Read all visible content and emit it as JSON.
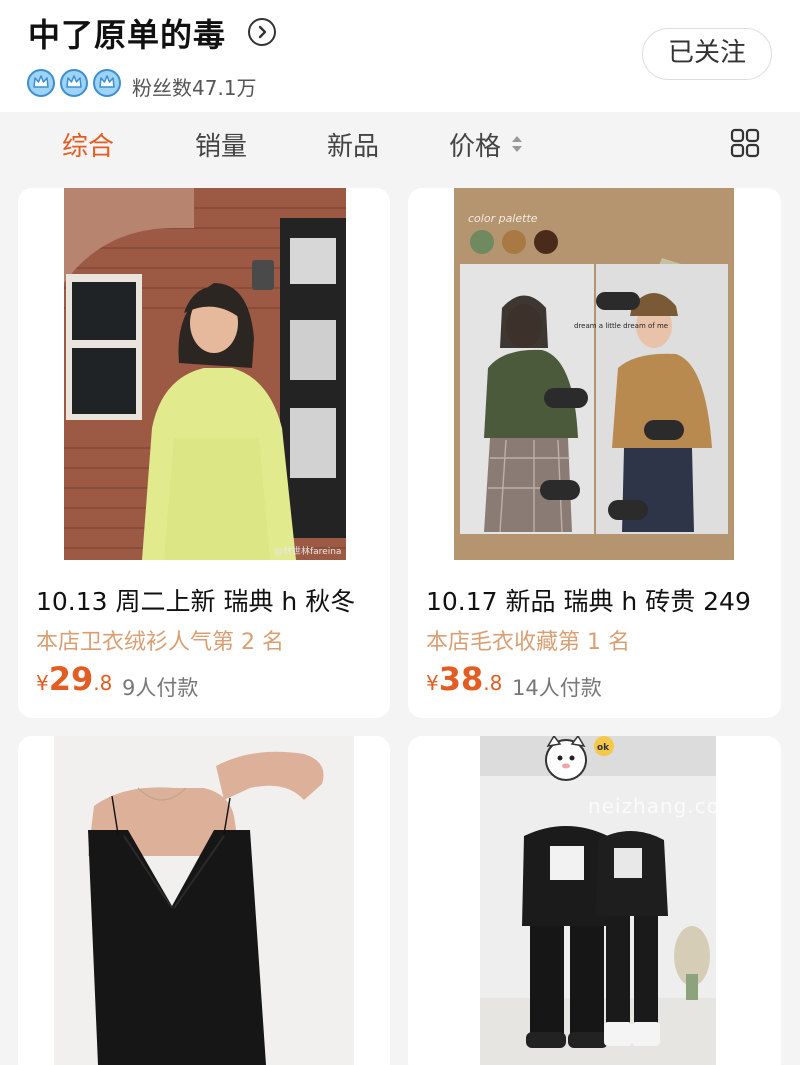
{
  "shop": {
    "name": "中了原单的毒",
    "fans_text": "粉丝数47.1万",
    "follow_label": "已关注",
    "crown_count": 3
  },
  "tabs": [
    {
      "label": "综合",
      "active": true
    },
    {
      "label": "销量",
      "active": false
    },
    {
      "label": "新品",
      "active": false
    },
    {
      "label": "价格",
      "active": false
    }
  ],
  "watermarks": {
    "weibo": "@林世林fareina",
    "site": "neizhang.com"
  },
  "products": [
    {
      "title": "10.13 周二上新 瑞典 h 秋冬",
      "rank": "本店卫衣绒衫人气第 2 名",
      "currency": "¥",
      "price_int": "29",
      "price_dec": ".8",
      "sales": "9人付款"
    },
    {
      "title": "10.17 新品 瑞典 h 砖贵 249",
      "rank": "本店毛衣收藏第 1 名",
      "currency": "¥",
      "price_int": "38",
      "price_dec": ".8",
      "sales": "14人付款",
      "image_text": {
        "palette_label": "color palette",
        "note": "dream a little dream of me",
        "swatches": [
          "#6f8a5e",
          "#a87942",
          "#4a2b1a"
        ]
      }
    },
    {},
    {
      "sticker": "ok"
    }
  ],
  "colors": {
    "accent": "#e35d22",
    "rank": "#d99f73",
    "crown": "#5aa9e6"
  }
}
